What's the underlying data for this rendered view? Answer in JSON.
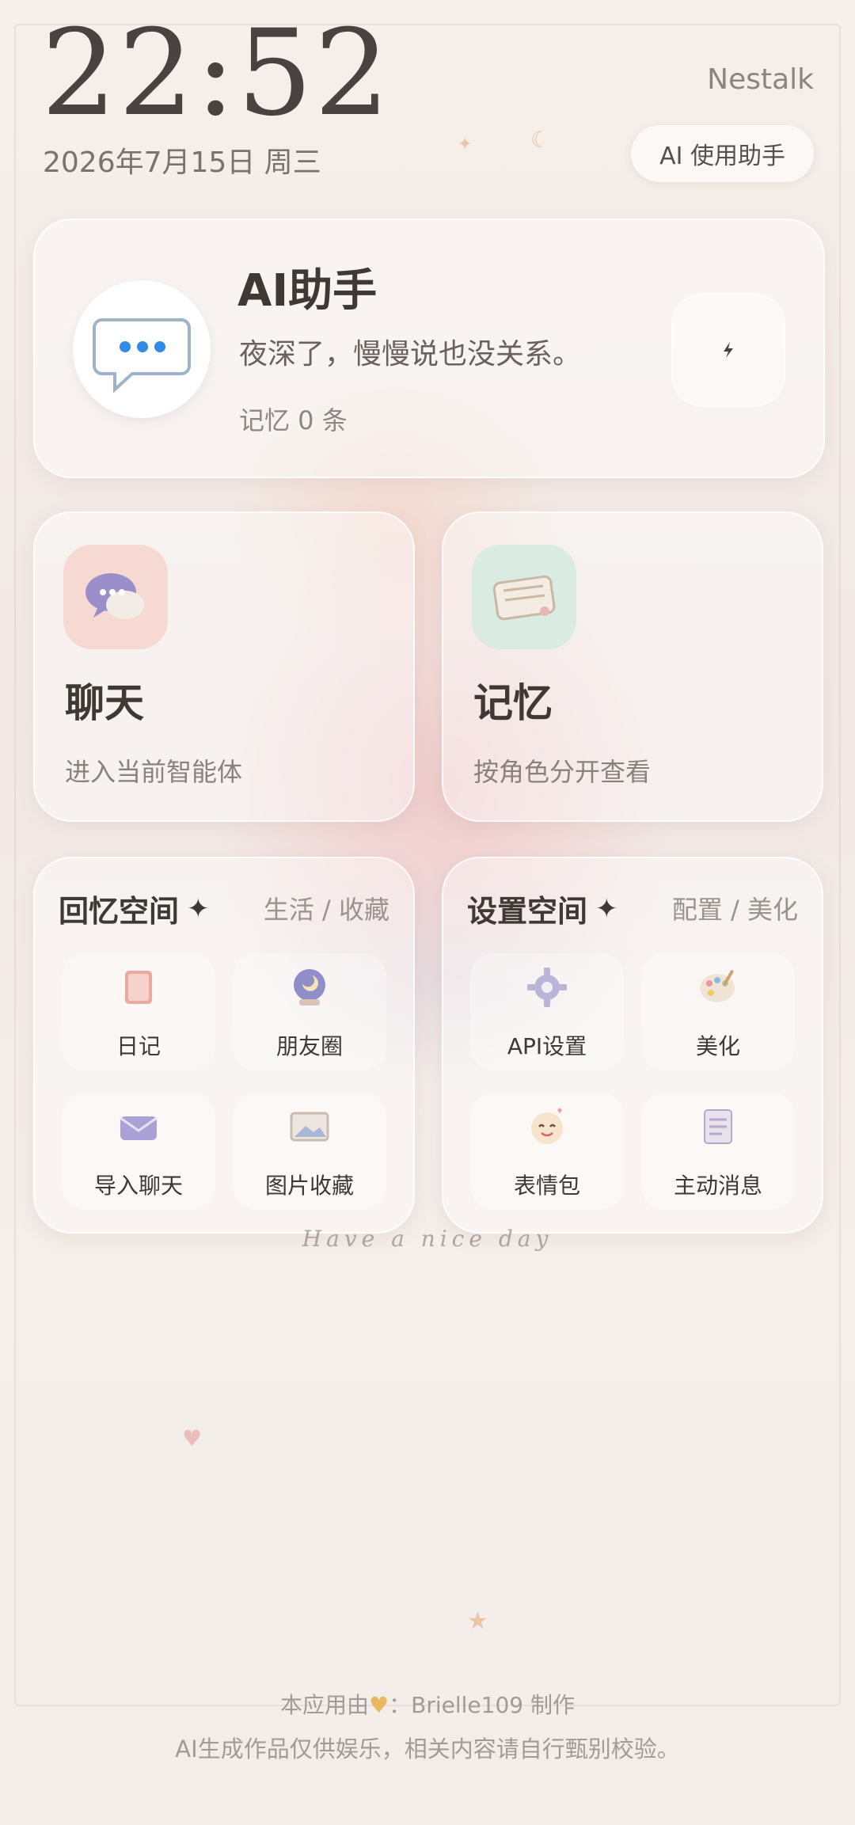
{
  "status": {
    "time": "22:52",
    "date": "2026年7月15日 周三",
    "brand": "Nestalk",
    "assistant_pill": "AI 使用助手"
  },
  "hero": {
    "title": "AI助手",
    "subtitle": "夜深了，慢慢说也没关系。",
    "memory_count": "记忆 0 条"
  },
  "cards": {
    "chat": {
      "title": "聊天",
      "subtitle": "进入当前智能体"
    },
    "memory": {
      "title": "记忆",
      "subtitle": "按角色分开查看"
    }
  },
  "panels": {
    "recall": {
      "title": "回忆空间",
      "tag": "生活 / 收藏",
      "items": [
        "日记",
        "朋友圈",
        "导入聊天",
        "图片收藏"
      ]
    },
    "settings": {
      "title": "设置空间",
      "tag": "配置 / 美化",
      "items": [
        "API设置",
        "美化",
        "表情包",
        "主动消息"
      ]
    }
  },
  "wallpaper_text": "Have a nice day",
  "footer": {
    "credit_prefix": "本应用由",
    "credit_author": "：Brielle109 制作",
    "disclaimer": "AI生成作品仅供娱乐，相关内容请自行甄别校验。"
  },
  "colors": {
    "chat_icon_bg": "#f7d9d3",
    "memory_icon_bg": "#d9ebe2",
    "chat_bubble": "#9a8fc9",
    "hero_dots": "#2f8be6"
  }
}
